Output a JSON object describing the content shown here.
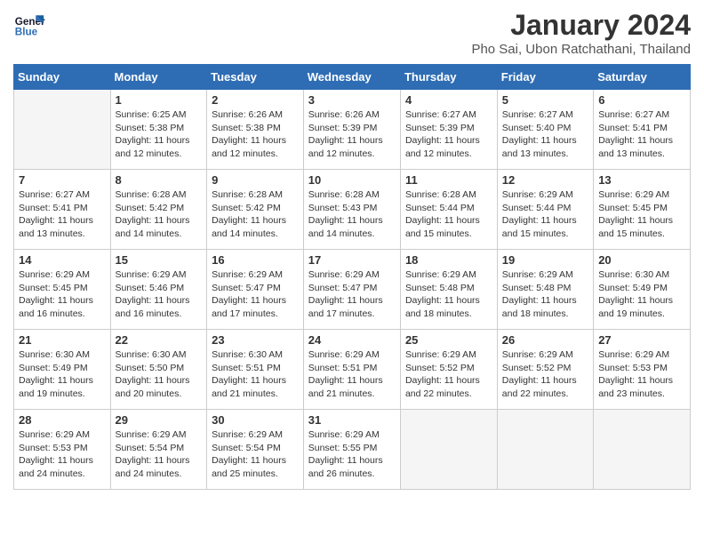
{
  "logo": {
    "line1": "General",
    "line2": "Blue"
  },
  "title": "January 2024",
  "subtitle": "Pho Sai, Ubon Ratchathani, Thailand",
  "days_of_week": [
    "Sunday",
    "Monday",
    "Tuesday",
    "Wednesday",
    "Thursday",
    "Friday",
    "Saturday"
  ],
  "weeks": [
    [
      {
        "day": "",
        "info": ""
      },
      {
        "day": "1",
        "info": "Sunrise: 6:25 AM\nSunset: 5:38 PM\nDaylight: 11 hours\nand 12 minutes."
      },
      {
        "day": "2",
        "info": "Sunrise: 6:26 AM\nSunset: 5:38 PM\nDaylight: 11 hours\nand 12 minutes."
      },
      {
        "day": "3",
        "info": "Sunrise: 6:26 AM\nSunset: 5:39 PM\nDaylight: 11 hours\nand 12 minutes."
      },
      {
        "day": "4",
        "info": "Sunrise: 6:27 AM\nSunset: 5:39 PM\nDaylight: 11 hours\nand 12 minutes."
      },
      {
        "day": "5",
        "info": "Sunrise: 6:27 AM\nSunset: 5:40 PM\nDaylight: 11 hours\nand 13 minutes."
      },
      {
        "day": "6",
        "info": "Sunrise: 6:27 AM\nSunset: 5:41 PM\nDaylight: 11 hours\nand 13 minutes."
      }
    ],
    [
      {
        "day": "7",
        "info": "Sunrise: 6:27 AM\nSunset: 5:41 PM\nDaylight: 11 hours\nand 13 minutes."
      },
      {
        "day": "8",
        "info": "Sunrise: 6:28 AM\nSunset: 5:42 PM\nDaylight: 11 hours\nand 14 minutes."
      },
      {
        "day": "9",
        "info": "Sunrise: 6:28 AM\nSunset: 5:42 PM\nDaylight: 11 hours\nand 14 minutes."
      },
      {
        "day": "10",
        "info": "Sunrise: 6:28 AM\nSunset: 5:43 PM\nDaylight: 11 hours\nand 14 minutes."
      },
      {
        "day": "11",
        "info": "Sunrise: 6:28 AM\nSunset: 5:44 PM\nDaylight: 11 hours\nand 15 minutes."
      },
      {
        "day": "12",
        "info": "Sunrise: 6:29 AM\nSunset: 5:44 PM\nDaylight: 11 hours\nand 15 minutes."
      },
      {
        "day": "13",
        "info": "Sunrise: 6:29 AM\nSunset: 5:45 PM\nDaylight: 11 hours\nand 15 minutes."
      }
    ],
    [
      {
        "day": "14",
        "info": "Sunrise: 6:29 AM\nSunset: 5:45 PM\nDaylight: 11 hours\nand 16 minutes."
      },
      {
        "day": "15",
        "info": "Sunrise: 6:29 AM\nSunset: 5:46 PM\nDaylight: 11 hours\nand 16 minutes."
      },
      {
        "day": "16",
        "info": "Sunrise: 6:29 AM\nSunset: 5:47 PM\nDaylight: 11 hours\nand 17 minutes."
      },
      {
        "day": "17",
        "info": "Sunrise: 6:29 AM\nSunset: 5:47 PM\nDaylight: 11 hours\nand 17 minutes."
      },
      {
        "day": "18",
        "info": "Sunrise: 6:29 AM\nSunset: 5:48 PM\nDaylight: 11 hours\nand 18 minutes."
      },
      {
        "day": "19",
        "info": "Sunrise: 6:29 AM\nSunset: 5:48 PM\nDaylight: 11 hours\nand 18 minutes."
      },
      {
        "day": "20",
        "info": "Sunrise: 6:30 AM\nSunset: 5:49 PM\nDaylight: 11 hours\nand 19 minutes."
      }
    ],
    [
      {
        "day": "21",
        "info": "Sunrise: 6:30 AM\nSunset: 5:49 PM\nDaylight: 11 hours\nand 19 minutes."
      },
      {
        "day": "22",
        "info": "Sunrise: 6:30 AM\nSunset: 5:50 PM\nDaylight: 11 hours\nand 20 minutes."
      },
      {
        "day": "23",
        "info": "Sunrise: 6:30 AM\nSunset: 5:51 PM\nDaylight: 11 hours\nand 21 minutes."
      },
      {
        "day": "24",
        "info": "Sunrise: 6:29 AM\nSunset: 5:51 PM\nDaylight: 11 hours\nand 21 minutes."
      },
      {
        "day": "25",
        "info": "Sunrise: 6:29 AM\nSunset: 5:52 PM\nDaylight: 11 hours\nand 22 minutes."
      },
      {
        "day": "26",
        "info": "Sunrise: 6:29 AM\nSunset: 5:52 PM\nDaylight: 11 hours\nand 22 minutes."
      },
      {
        "day": "27",
        "info": "Sunrise: 6:29 AM\nSunset: 5:53 PM\nDaylight: 11 hours\nand 23 minutes."
      }
    ],
    [
      {
        "day": "28",
        "info": "Sunrise: 6:29 AM\nSunset: 5:53 PM\nDaylight: 11 hours\nand 24 minutes."
      },
      {
        "day": "29",
        "info": "Sunrise: 6:29 AM\nSunset: 5:54 PM\nDaylight: 11 hours\nand 24 minutes."
      },
      {
        "day": "30",
        "info": "Sunrise: 6:29 AM\nSunset: 5:54 PM\nDaylight: 11 hours\nand 25 minutes."
      },
      {
        "day": "31",
        "info": "Sunrise: 6:29 AM\nSunset: 5:55 PM\nDaylight: 11 hours\nand 26 minutes."
      },
      {
        "day": "",
        "info": ""
      },
      {
        "day": "",
        "info": ""
      },
      {
        "day": "",
        "info": ""
      }
    ]
  ]
}
